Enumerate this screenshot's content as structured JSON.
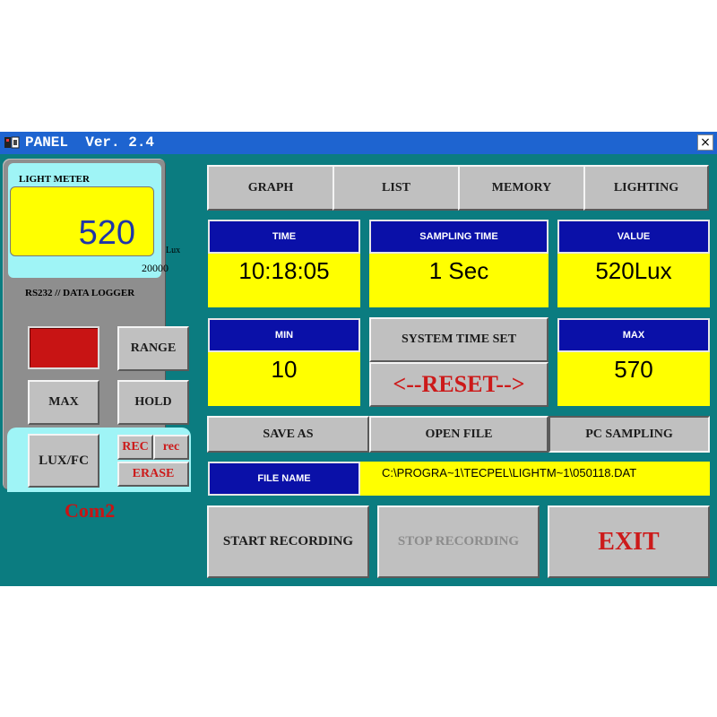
{
  "window": {
    "title": "PANEL  Ver. 2.4",
    "close_label": "×"
  },
  "meter": {
    "lcd_label": "LIGHT METER",
    "value": "520",
    "unit": "Lux",
    "range": "20000",
    "interface_label": "RS232 // DATA LOGGER",
    "buttons": {
      "range": "RANGE",
      "max": "MAX",
      "hold": "HOLD",
      "luxfc": "LUX/FC",
      "rec_upper": "REC",
      "rec_lower": "rec",
      "erase": "ERASE"
    },
    "port": "Com2"
  },
  "tabs": [
    "GRAPH",
    "LIST",
    "MEMORY",
    "LIGHTING"
  ],
  "readouts": {
    "time": {
      "label": "TIME",
      "value": "10:18:05"
    },
    "sampling": {
      "label": "SAMPLING TIME",
      "value": "1 Sec"
    },
    "value": {
      "label": "VALUE",
      "value": "520Lux"
    },
    "min": {
      "label": "MIN",
      "value": "10"
    },
    "max": {
      "label": "MAX",
      "value": "570"
    }
  },
  "controls": {
    "system_time_set": "SYSTEM TIME SET",
    "reset": "<--RESET-->",
    "save_as": "SAVE AS",
    "open_file": "OPEN FILE",
    "pc_sampling": "PC SAMPLING",
    "file_name_label": "FILE NAME",
    "file_name_value": "C:\\PROGRA~1\\TECPEL\\LIGHTM~1\\050118.DAT",
    "start_recording": "START RECORDING",
    "stop_recording": "STOP RECORDING",
    "exit": "EXIT"
  },
  "colors": {
    "window_bg": "#0b7c80",
    "titlebar": "#1e64d0",
    "header_blue": "#0a10a8",
    "display_yellow": "#ffff00",
    "accent_red": "#c81414"
  }
}
